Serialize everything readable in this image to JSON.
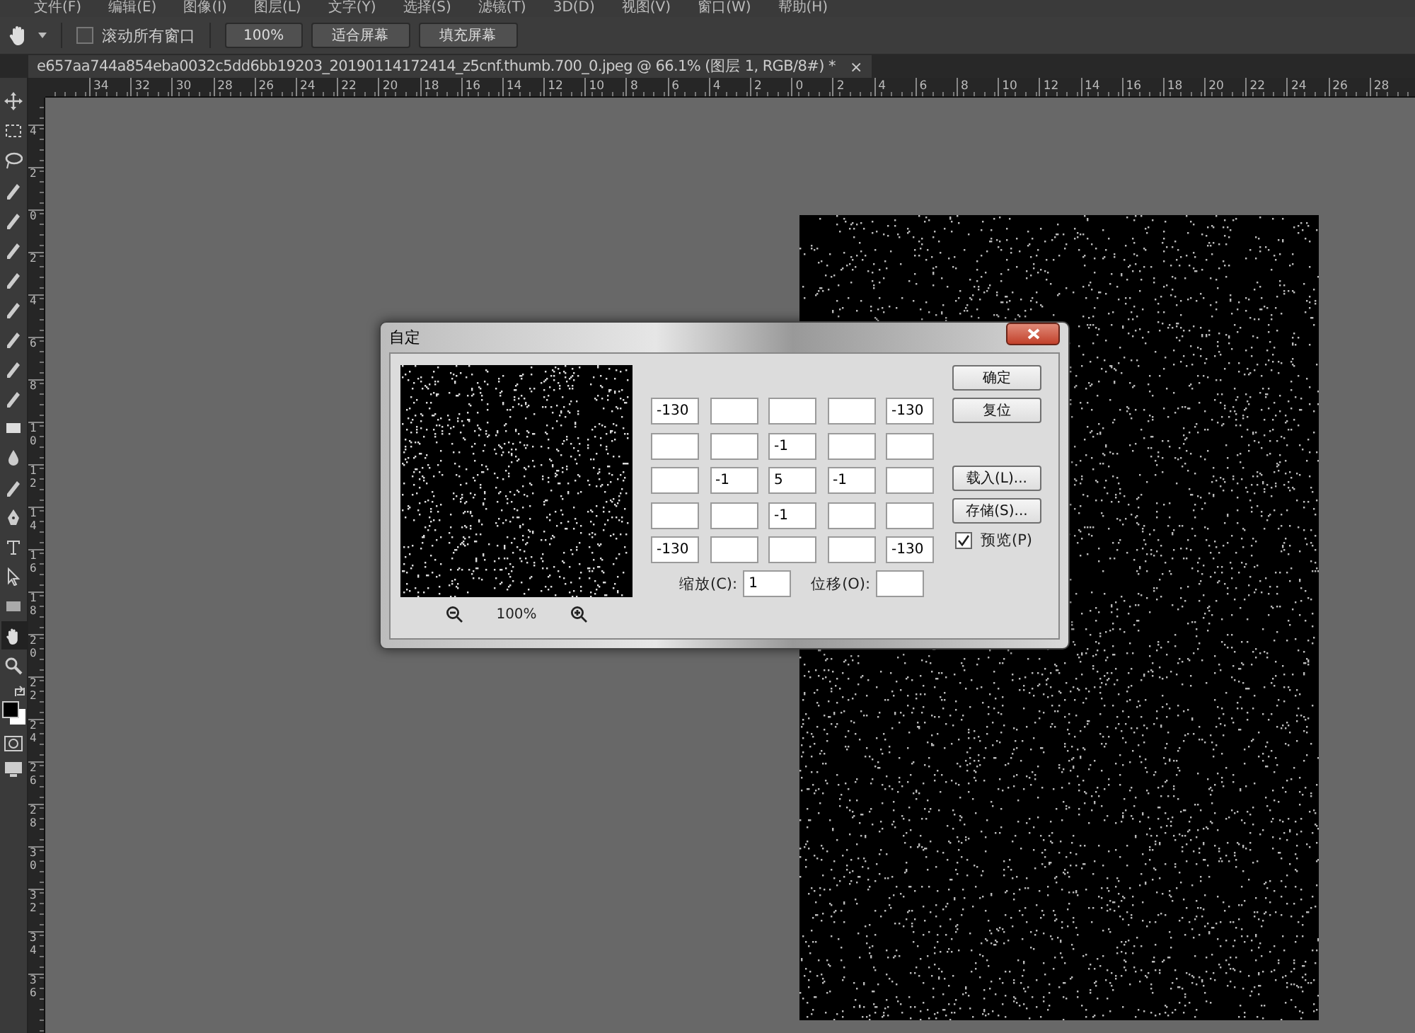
{
  "menu_bar": [
    "文件(F)",
    "编辑(E)",
    "图像(I)",
    "图层(L)",
    "文字(Y)",
    "选择(S)",
    "滤镜(T)",
    "3D(D)",
    "视图(V)",
    "窗口(W)",
    "帮助(H)"
  ],
  "options_bar": {
    "scroll_all_windows": {
      "label": "滚动所有窗口",
      "checked": false
    },
    "buttons": [
      "100%",
      "适合屏幕",
      "填充屏幕"
    ]
  },
  "document_tab": {
    "title": "e657aa744a854eba0032c5dd6bb19203_20190114172414_z5cnf.thumb.700_0.jpeg @ 66.1% (图层 1, RGB/8#) *",
    "close": "×"
  },
  "horizontal_ruler": [
    "34",
    "32",
    "30",
    "28",
    "26",
    "24",
    "22",
    "20",
    "18",
    "16",
    "14",
    "12",
    "10",
    "8",
    "6",
    "4",
    "2",
    "0",
    "2",
    "4",
    "6",
    "8",
    "10",
    "12",
    "14",
    "16",
    "18",
    "20",
    "22",
    "24",
    "26",
    "28"
  ],
  "vertical_ruler": [
    "4",
    "2",
    "0",
    "2",
    "4",
    "6",
    "8",
    "10",
    "12",
    "14",
    "16",
    "18",
    "20",
    "22",
    "24",
    "26",
    "28",
    "30",
    "32",
    "34",
    "36"
  ],
  "tools": [
    {
      "selected": false
    },
    {
      "selected": false
    },
    {
      "selected": false
    },
    {
      "selected": false
    },
    {
      "selected": false
    },
    {
      "selected": false
    },
    {
      "selected": false
    },
    {
      "selected": false
    },
    {
      "selected": false
    },
    {
      "selected": false
    },
    {
      "selected": false
    },
    {
      "selected": false
    },
    {
      "selected": false
    },
    {
      "selected": false
    },
    {
      "selected": false
    },
    {
      "selected": false
    },
    {
      "selected": false
    },
    {
      "selected": false
    },
    {
      "selected": true
    },
    {
      "selected": false
    }
  ],
  "dialog": {
    "title": "自定",
    "zoom_level": "100%",
    "matrix": [
      [
        {
          "value": "-130"
        },
        {
          "blank": true
        },
        {
          "blank": true
        },
        {
          "blank": true
        },
        {
          "value": "-130"
        }
      ],
      [
        {
          "blank": true
        },
        {
          "blank": true
        },
        {
          "value": "-1"
        },
        {
          "blank": true
        },
        {
          "blank": true
        }
      ],
      [
        {
          "blank": true
        },
        {
          "value": "-1"
        },
        {
          "value": "5"
        },
        {
          "value": "-1"
        },
        {
          "blank": true
        }
      ],
      [
        {
          "blank": true
        },
        {
          "blank": true
        },
        {
          "value": "-1"
        },
        {
          "blank": true
        },
        {
          "blank": true
        }
      ],
      [
        {
          "value": "-130"
        },
        {
          "blank": true
        },
        {
          "blank": true
        },
        {
          "blank": true
        },
        {
          "value": "-130"
        }
      ]
    ],
    "buttons": [
      "确定",
      "复位",
      "载入(L)...",
      "存储(S)..."
    ],
    "preview": {
      "label": "预览(P)",
      "checked": true
    },
    "scale": {
      "label": "缩放(C):",
      "value": "1"
    },
    "offset": {
      "label": "位移(O):"
    }
  }
}
